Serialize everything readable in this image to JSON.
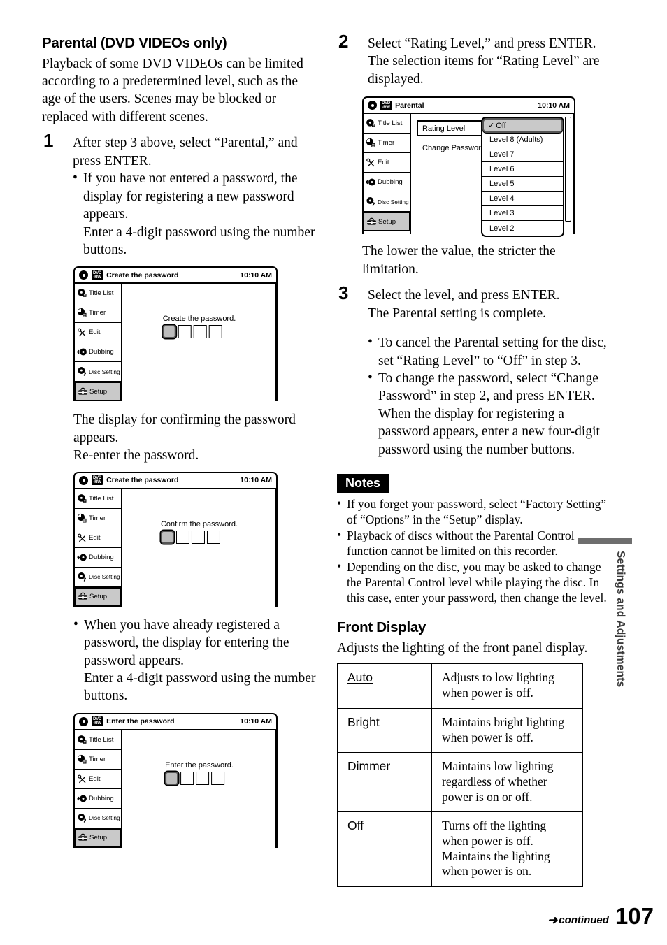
{
  "left": {
    "heading": "Parental (DVD VIDEOs only)",
    "intro": "Playback of some DVD VIDEOs can be limited according to a predetermined level, such as the age of the users. Scenes may be blocked or replaced with different scenes.",
    "step1": {
      "num": "1",
      "text": "After step 3 above, select “Parental,” and press ENTER.",
      "bullet": "If you have not entered a password, the display for registering a new password appears.",
      "bullet_cont": "Enter a 4-digit password using the number buttons."
    },
    "after_fig1": "The display for confirming the password appears.",
    "after_fig1_b": "Re-enter the password.",
    "bullet2": "When you have already registered a password, the display for entering the password appears.",
    "bullet2_cont": "Enter a 4-digit password using the number buttons."
  },
  "right": {
    "step2": {
      "num": "2",
      "text": "Select “Rating Level,” and press ENTER. The selection items for “Rating Level” are displayed."
    },
    "after_fig": "The lower the value, the stricter the limitation.",
    "step3": {
      "num": "3",
      "line1": "Select the level, and press ENTER.",
      "line2": "The Parental setting is complete.",
      "bullet1": "To cancel the Parental setting for the disc, set “Rating Level” to “Off” in step 3.",
      "bullet2": "To change the password, select “Change Password” in step 2, and press ENTER. When the display for registering a password appears, enter a new four-digit password using the number buttons."
    },
    "notes": {
      "title": "Notes",
      "items": [
        "If you forget your password, select “Factory Setting” of “Options” in the “Setup” display.",
        "Playback of discs without the Parental Control function cannot be limited on this recorder.",
        "Depending on the disc, you may be asked to change the Parental Control level while playing the disc. In this case, enter your password, then change the level."
      ]
    },
    "front_display": {
      "heading": "Front Display",
      "desc": "Adjusts the lighting of the front panel display.",
      "rows": [
        {
          "term": "Auto",
          "underlined": true,
          "desc": "Adjusts to low lighting when power is off."
        },
        {
          "term": "Bright",
          "underlined": false,
          "desc": "Maintains bright lighting when power is off."
        },
        {
          "term": "Dimmer",
          "underlined": false,
          "desc": "Maintains low lighting regardless of whether power is on or off."
        },
        {
          "term": "Off",
          "underlined": false,
          "desc": "Turns off the lighting when power is off. Maintains the lighting when power is on."
        }
      ]
    }
  },
  "osd_nav": [
    {
      "label": "Title List",
      "icon": "title-list-icon",
      "small": false
    },
    {
      "label": "Timer",
      "icon": "timer-icon",
      "small": false
    },
    {
      "label": "Edit",
      "icon": "edit-scissors-icon",
      "small": false
    },
    {
      "label": "Dubbing",
      "icon": "dubbing-icon",
      "small": false
    },
    {
      "label": "Disc Setting",
      "icon": "disc-setting-icon",
      "small": true
    },
    {
      "label": "Setup",
      "icon": "setup-toolbox-icon",
      "small": false
    }
  ],
  "osd_badge": {
    "line1": "DVD",
    "line2": "-RW"
  },
  "figures": {
    "fig1": {
      "title": "Create the password",
      "clock": "10:10 AM",
      "caption": "Create the password."
    },
    "fig2": {
      "title": "Create the password",
      "clock": "10:10 AM",
      "caption": "Confirm the password."
    },
    "fig3": {
      "title": "Enter the password",
      "clock": "10:10 AM",
      "caption": "Enter the password."
    },
    "fig_parental": {
      "title": "Parental",
      "clock": "10:10 AM",
      "menu": [
        "Rating Level",
        "Change Password"
      ],
      "colon": ":",
      "dropdown": [
        {
          "label": "Off",
          "checked": true
        },
        {
          "label": "Level 8 (Adults)",
          "checked": false
        },
        {
          "label": "Level 7",
          "checked": false
        },
        {
          "label": "Level 6",
          "checked": false
        },
        {
          "label": "Level 5",
          "checked": false
        },
        {
          "label": "Level 4",
          "checked": false
        },
        {
          "label": "Level 3",
          "checked": false
        },
        {
          "label": "Level 2",
          "checked": false
        }
      ],
      "check_glyph": "✓"
    }
  },
  "side_tab": {
    "label": "Settings and Adjustments"
  },
  "footer": {
    "arrow": "➡",
    "continued": "continued",
    "page": "107"
  },
  "colors": {
    "highlight": "#c9c9c9",
    "ink": "#000000",
    "side_gray": "#6e6e6e"
  }
}
